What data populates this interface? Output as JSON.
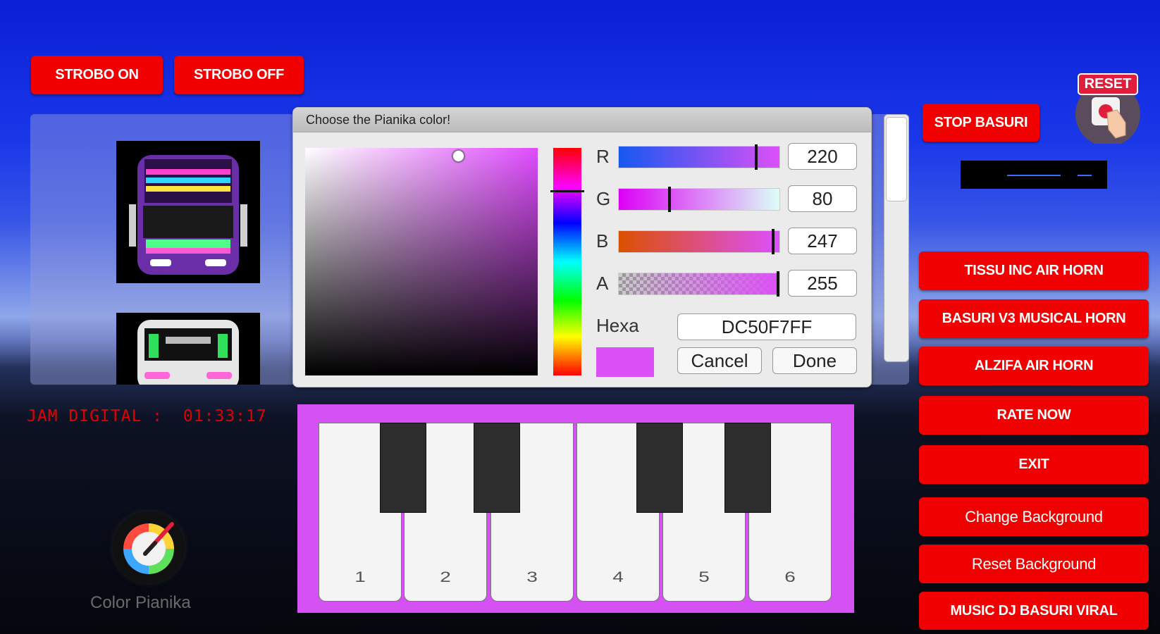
{
  "top_buttons": {
    "strobo_on": "STROBO ON",
    "strobo_off": "STROBO OFF"
  },
  "right_top": {
    "stop_basuri": "STOP BASURI",
    "reset": "RESET"
  },
  "right_menu": [
    "TISSU INC AIR HORN",
    "BASURI V3 MUSICAL HORN",
    "ALZIFA AIR HORN",
    "RATE NOW",
    "EXIT",
    "Change Background",
    "Reset Background",
    "MUSIC DJ BASURI VIRAL"
  ],
  "color_dialog": {
    "title": "Choose the Pianika color!",
    "r_label": "R",
    "r_value": "220",
    "g_label": "G",
    "g_value": "80",
    "b_label": "B",
    "b_value": "247",
    "a_label": "A",
    "a_value": "255",
    "hexa_label": "Hexa",
    "hexa_value": "DC50F7FF",
    "cancel": "Cancel",
    "done": "Done",
    "selected_color": "#dc50f7",
    "r_level": 0.863,
    "g_level": 0.314,
    "b_level": 0.969,
    "a_level": 1.0
  },
  "piano": {
    "color": "#d651f4",
    "white_keys": [
      "1",
      "2",
      "3",
      "4",
      "5",
      "6"
    ]
  },
  "clock": {
    "label": "JAM DIGITAL :",
    "time": "01:33:17"
  },
  "color_pianika_label": "Color Pianika",
  "colors": {
    "button_red": "#f00000",
    "dialog_bg": "#ebebeb"
  }
}
